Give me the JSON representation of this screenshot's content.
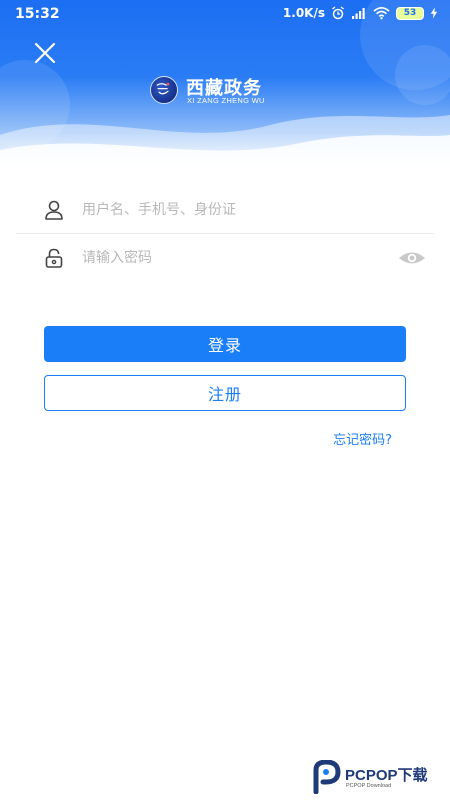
{
  "status_bar": {
    "time": "15:32",
    "net_speed": "1.0K/s",
    "battery": "53"
  },
  "header": {
    "logo_title": "西藏政务",
    "logo_subtitle": "XI ZANG ZHENG WU"
  },
  "form": {
    "username_placeholder": "用户名、手机号、身份证",
    "password_placeholder": "请输入密码",
    "login_label": "登录",
    "register_label": "注册",
    "forgot_label": "忘记密码?"
  },
  "watermark": {
    "brand": "PCPOP下载",
    "sub": "PCPOP Download"
  },
  "colors": {
    "primary": "#1a7ef8",
    "header_top": "#1c6ef2",
    "placeholder": "#b8b8b8"
  },
  "icons": [
    "close-icon",
    "user-icon",
    "lock-icon",
    "eye-icon",
    "alarm-icon",
    "signal-icon",
    "wifi-icon",
    "charging-icon"
  ]
}
